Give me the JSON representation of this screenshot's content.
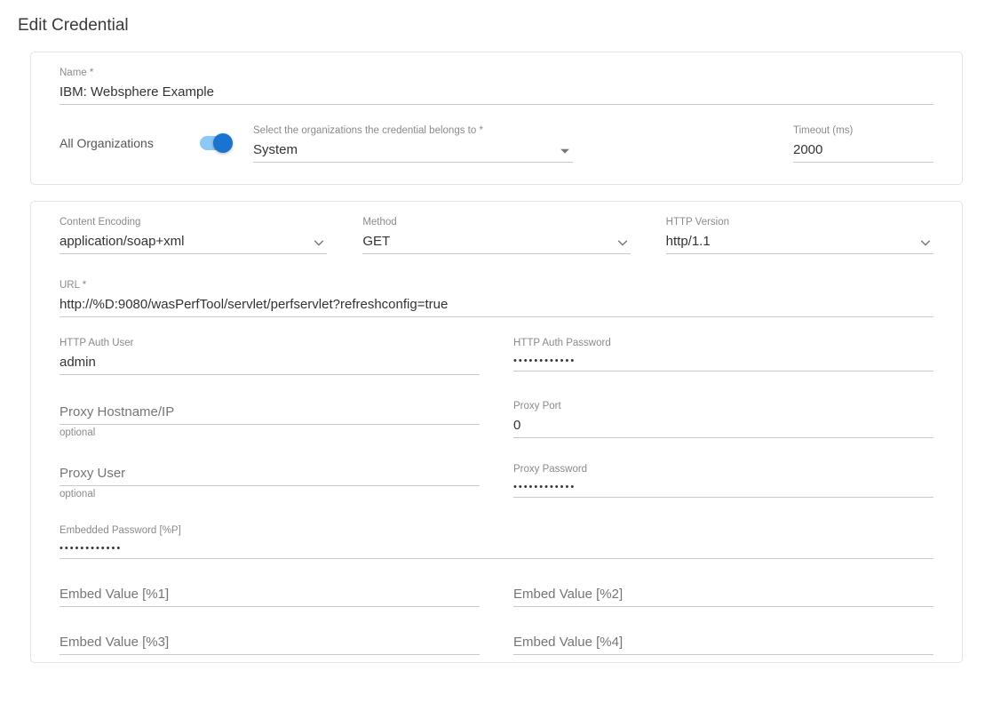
{
  "page_title": "Edit Credential",
  "card1": {
    "name_label": "Name *",
    "name_value": "IBM: Websphere Example",
    "all_orgs_label": "All Organizations",
    "org_label": "Select the organizations the credential belongs to *",
    "org_value": "System",
    "timeout_label": "Timeout (ms)",
    "timeout_value": "2000"
  },
  "card2": {
    "encoding_label": "Content Encoding",
    "encoding_value": "application/soap+xml",
    "method_label": "Method",
    "method_value": "GET",
    "httpver_label": "HTTP Version",
    "httpver_value": "http/1.1",
    "url_label": "URL *",
    "url_value": "http://%D:9080/wasPerfTool/servlet/perfservlet?refreshconfig=true",
    "auth_user_label": "HTTP Auth User",
    "auth_user_value": "admin",
    "auth_pw_label": "HTTP Auth Password",
    "auth_pw_value": "••••••••••••",
    "proxy_host_label": "Proxy Hostname/IP",
    "proxy_host_helper": "optional",
    "proxy_port_label": "Proxy Port",
    "proxy_port_value": "0",
    "proxy_user_label": "Proxy User",
    "proxy_user_helper": "optional",
    "proxy_pw_label": "Proxy Password",
    "proxy_pw_value": "••••••••••••",
    "embed_pw_label": "Embedded Password [%P]",
    "embed_pw_value": "••••••••••••",
    "embed1_label": "Embed Value [%1]",
    "embed2_label": "Embed Value [%2]",
    "embed3_label": "Embed Value [%3]",
    "embed4_label": "Embed Value [%4]"
  }
}
